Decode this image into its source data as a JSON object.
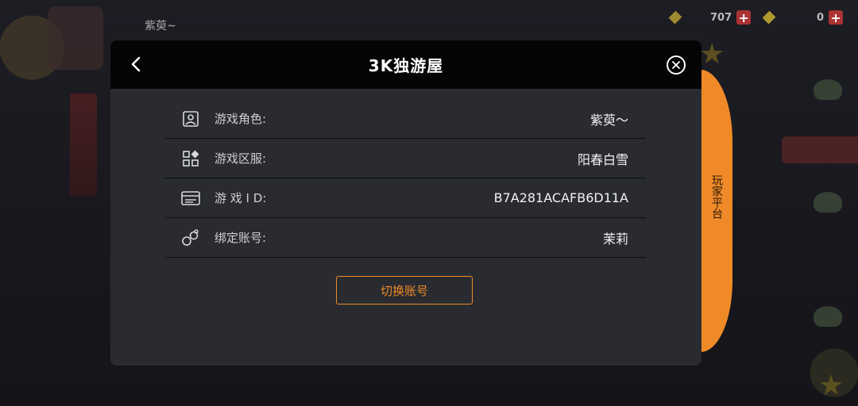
{
  "background": {
    "player_name": "紫萸~",
    "currency_1": "707",
    "currency_2": "0"
  },
  "modal": {
    "title": "3K独游屋",
    "rows": [
      {
        "label": "游戏角色:",
        "value": "紫萸～",
        "icon": "user-card-icon"
      },
      {
        "label": "游戏区服:",
        "value": "阳春白雪",
        "icon": "server-grid-icon"
      },
      {
        "label": "游 戏 I D:",
        "value": "B7A281ACAFB6D11A",
        "icon": "id-card-icon"
      },
      {
        "label": "绑定账号:",
        "value": "茉莉",
        "icon": "link-account-icon"
      }
    ],
    "switch_button": "切换账号"
  },
  "side_tab": {
    "label": "玩家平台"
  },
  "colors": {
    "accent": "#f08a28",
    "header_bg": "#050506",
    "panel_bg": "#2a2c32"
  }
}
